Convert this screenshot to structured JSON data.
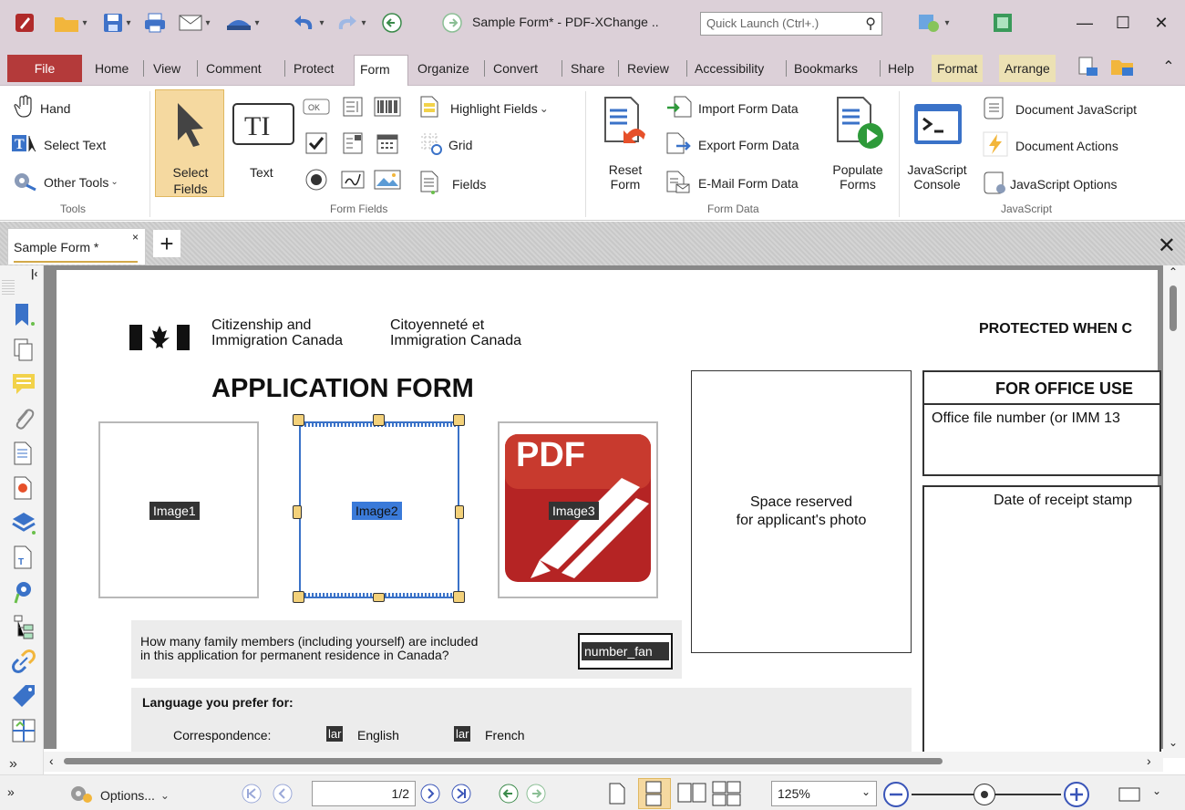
{
  "window": {
    "title": "Sample Form* - PDF-XChange ..",
    "quick_launch_placeholder": "Quick Launch (Ctrl+.)",
    "min": "—",
    "max": "☐",
    "close": "✕"
  },
  "menu": {
    "file": "File",
    "tabs": [
      "Home",
      "View",
      "Comment",
      "Protect",
      "Form",
      "Organize",
      "Convert",
      "Share",
      "Review",
      "Accessibility",
      "Bookmarks",
      "Help",
      "Format",
      "Arrange"
    ],
    "active": "Form"
  },
  "ribbon": {
    "tools": {
      "hand": "Hand",
      "select_text": "Select Text",
      "other_tools": "Other Tools",
      "group": "Tools"
    },
    "form_fields": {
      "select_fields_1": "Select",
      "select_fields_2": "Fields",
      "text": "Text",
      "highlight_fields": "Highlight Fields",
      "grid": "Grid",
      "fields": "Fields",
      "group": "Form Fields"
    },
    "form_data": {
      "reset_1": "Reset",
      "reset_2": "Form",
      "import": "Import Form Data",
      "export": "Export Form Data",
      "email": "E-Mail Form Data",
      "populate_1": "Populate",
      "populate_2": "Forms",
      "group": "Form Data"
    },
    "javascript": {
      "console_1": "JavaScript",
      "console_2": "Console",
      "doc_js": "Document JavaScript",
      "doc_actions": "Document Actions",
      "js_options": "JavaScript Options",
      "group": "JavaScript"
    }
  },
  "doc_tab": {
    "label": "Sample Form *",
    "close": "×",
    "new": "+"
  },
  "page": {
    "agency_en_1": "Citizenship and",
    "agency_en_2": "Immigration Canada",
    "agency_fr_1": "Citoyenneté et",
    "agency_fr_2": "Immigration Canada",
    "protected": "PROTECTED WHEN C",
    "heading": "APPLICATION FORM",
    "image1": "Image1",
    "image2": "Image2",
    "image3": "Image3",
    "pdf_logo": "PDF",
    "photo_1": "Space reserved",
    "photo_2": "for applicant's photo",
    "office_use": "FOR OFFICE USE",
    "office_file": "Office file number (or IMM 13",
    "receipt": "Date of receipt stamp",
    "family_q1": "How many family members (including yourself) are included",
    "family_q2": "in this application for permanent residence in Canada?",
    "family_field": "number_fan",
    "language": "Language you prefer for:",
    "correspondence": "Correspondence:",
    "lang_field": "lar",
    "english": "English",
    "french": "French"
  },
  "status": {
    "options": "Options...",
    "page": "1/2",
    "zoom": "125%"
  }
}
